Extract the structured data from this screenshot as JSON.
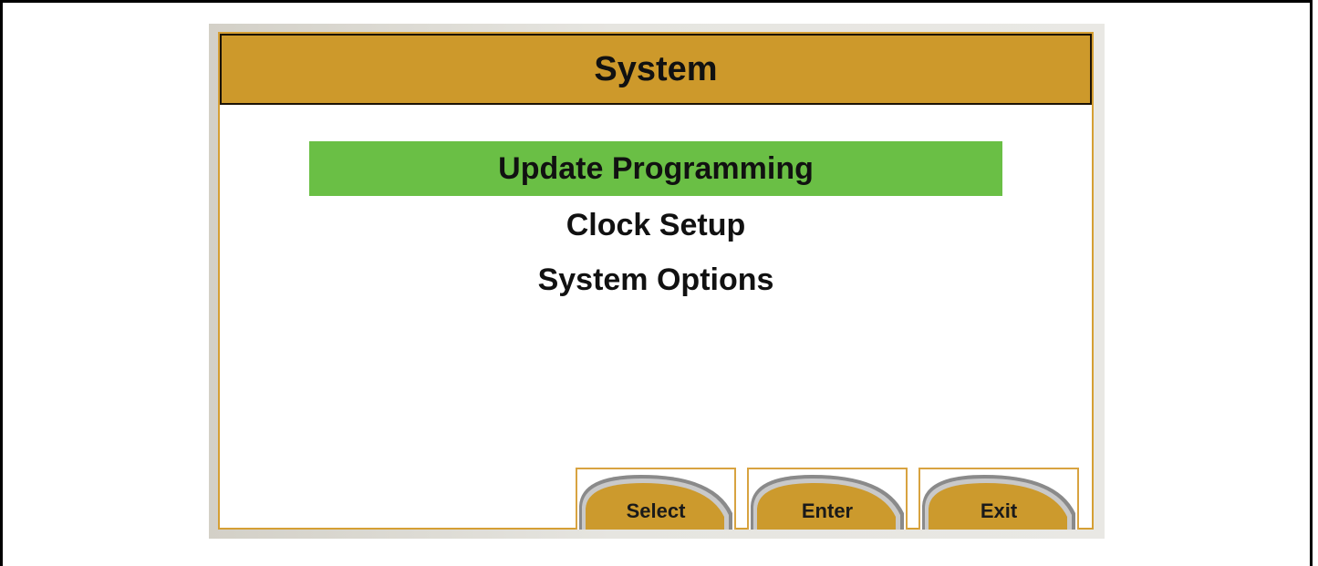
{
  "screen": {
    "title": "System"
  },
  "menu": {
    "items": [
      {
        "label": "Update Programming",
        "selected": true
      },
      {
        "label": "Clock Setup",
        "selected": false
      },
      {
        "label": "System Options",
        "selected": false
      }
    ]
  },
  "softkeys": [
    {
      "label": "Select"
    },
    {
      "label": "Enter"
    },
    {
      "label": "Exit"
    }
  ],
  "colors": {
    "title_bar": "#cd992b",
    "selection_highlight": "#6abf45",
    "softkey_fill": "#cc9a2d",
    "softkey_rim": "#6f6f6f",
    "screen_border": "#d59f34"
  }
}
